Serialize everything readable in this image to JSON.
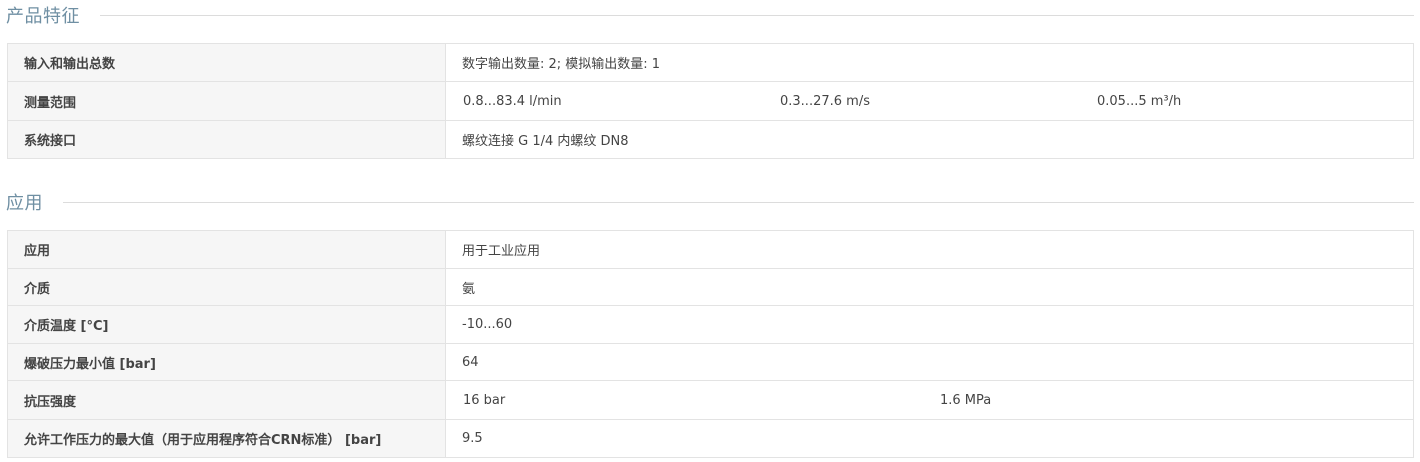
{
  "sections": [
    {
      "title": "产品特征",
      "rows": [
        {
          "label": "输入和输出总数",
          "values": [
            "数字输出数量: 2; 模拟输出数量: 1"
          ]
        },
        {
          "label": "测量范围",
          "values": [
            "0.8...83.4 l/min",
            "0.3...27.6 m/s",
            "0.05...5 m³/h"
          ]
        },
        {
          "label": "系统接口",
          "values": [
            "螺纹连接 G 1/4 内螺纹 DN8"
          ]
        }
      ]
    },
    {
      "title": "应用",
      "rows": [
        {
          "label": "应用",
          "values": [
            "用于工业应用"
          ]
        },
        {
          "label": "介质",
          "values": [
            "氨"
          ]
        },
        {
          "label": "介质温度 [°C]",
          "values": [
            "-10...60"
          ]
        },
        {
          "label": "爆破压力最小值 [bar]",
          "values": [
            "64"
          ]
        },
        {
          "label": "抗压强度",
          "values": [
            "16 bar",
            "1.6 MPa"
          ]
        },
        {
          "label": "允许工作压力的最大值（用于应用程序符合CRN标准） [bar]",
          "values": [
            "9.5"
          ]
        }
      ]
    }
  ]
}
